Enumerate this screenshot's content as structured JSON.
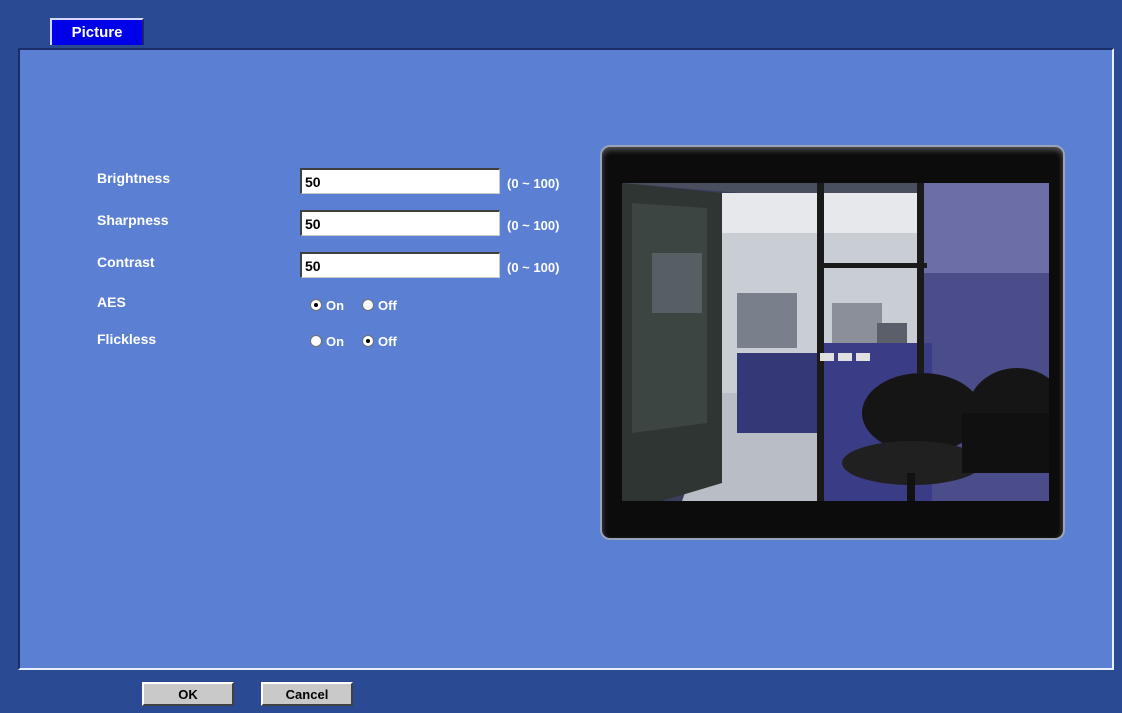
{
  "tab": {
    "label": "Picture"
  },
  "fields": [
    {
      "label": "Brightness",
      "value": "50",
      "range": "(0 ~ 100)"
    },
    {
      "label": "Sharpness",
      "value": "50",
      "range": "(0 ~ 100)"
    },
    {
      "label": "Contrast",
      "value": "50",
      "range": "(0 ~ 100)"
    }
  ],
  "aes": {
    "label": "AES",
    "on_label": "On",
    "off_label": "Off",
    "selected": "On"
  },
  "flickless": {
    "label": "Flickless",
    "on_label": "On",
    "off_label": "Off",
    "selected": "Off"
  },
  "buttons": {
    "ok": "OK",
    "cancel": "Cancel"
  },
  "colors": {
    "background": "#2a4a94",
    "panel": "#5b7fd3",
    "tab": "#0000e8"
  }
}
